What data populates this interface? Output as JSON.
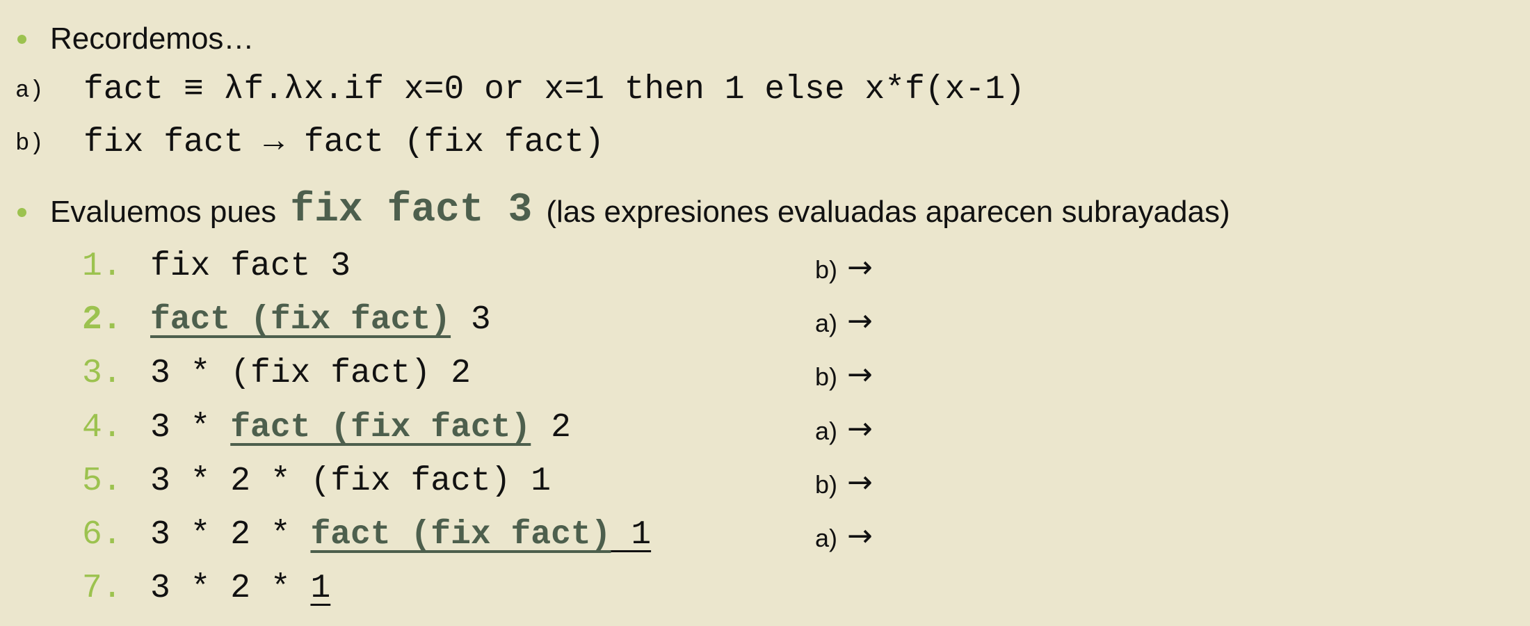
{
  "bullets": {
    "recall": "Recordemos…",
    "evaluate_prefix": "Evaluemos pues",
    "evaluate_code": "fix fact 3",
    "evaluate_suffix": "(las expresiones evaluadas aparecen subrayadas)"
  },
  "definitions": [
    {
      "label": "a)",
      "code": "fact ≡ λf.λx.if x=0 or x=1 then 1 else x*f(x-1)"
    },
    {
      "label": "b)",
      "code": "fix fact → fact (fix fact)"
    }
  ],
  "steps": [
    {
      "number": "1.",
      "active": false,
      "segments": [
        {
          "text": "fix fact 3",
          "style": "plain"
        }
      ],
      "rule": "b)",
      "arrow": "→"
    },
    {
      "number": "2.",
      "active": true,
      "segments": [
        {
          "text": "fact (fix fact)",
          "style": "eval"
        },
        {
          "text": " 3",
          "style": "plain"
        }
      ],
      "rule": "a)",
      "arrow": "→"
    },
    {
      "number": "3.",
      "active": false,
      "segments": [
        {
          "text": "3 * (fix fact) 2",
          "style": "plain"
        }
      ],
      "rule": "b)",
      "arrow": "→"
    },
    {
      "number": "4.",
      "active": false,
      "segments": [
        {
          "text": "3 * ",
          "style": "plain"
        },
        {
          "text": "fact (fix fact)",
          "style": "eval"
        },
        {
          "text": " 2",
          "style": "plain"
        }
      ],
      "rule": "a)",
      "arrow": "→"
    },
    {
      "number": "5.",
      "active": false,
      "segments": [
        {
          "text": "3 * 2 * (fix fact) 1",
          "style": "plain"
        }
      ],
      "rule": "b)",
      "arrow": "→"
    },
    {
      "number": "6.",
      "active": false,
      "segments": [
        {
          "text": "3 * 2 * ",
          "style": "plain"
        },
        {
          "text": "fact (fix fact)",
          "style": "eval"
        },
        {
          "text": " 1",
          "style": "underline"
        }
      ],
      "rule": "a)",
      "arrow": "→"
    },
    {
      "number": "7.",
      "active": false,
      "segments": [
        {
          "text": "3 * 2 * ",
          "style": "plain"
        },
        {
          "text": "1",
          "style": "underline"
        }
      ],
      "rule": "",
      "arrow": ""
    }
  ],
  "colors": {
    "background": "#ebe6cd",
    "accent_green": "#9cc24f",
    "code_dark_green": "#4d5f4d",
    "text": "#111111"
  }
}
